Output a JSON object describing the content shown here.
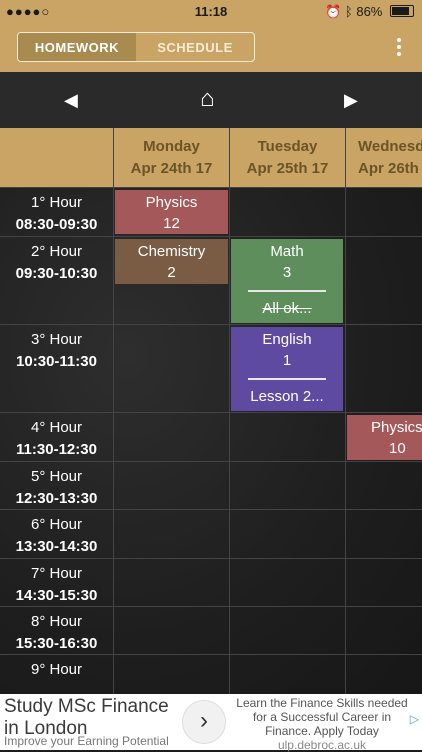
{
  "status_bar": {
    "signal": "●●●●○",
    "wifi": "WiFi",
    "time": "11:18",
    "battery": "86%"
  },
  "tabs": [
    {
      "label": "HOMEWORK",
      "active": true
    },
    {
      "label": "SCHEDULE",
      "active": false
    }
  ],
  "nav": {
    "prev": "◀",
    "home": "⌂",
    "next": "▶"
  },
  "days": [
    {
      "name": "Monday",
      "date": "Apr 24th 17"
    },
    {
      "name": "Tuesday",
      "date": "Apr 25th 17"
    },
    {
      "name": "Wednesd",
      "date": "Apr 26th"
    }
  ],
  "hours": [
    {
      "label": "1° Hour",
      "time": "08:30-09:30"
    },
    {
      "label": "2° Hour",
      "time": "09:30-10:30"
    },
    {
      "label": "3° Hour",
      "time": "10:30-11:30"
    },
    {
      "label": "4° Hour",
      "time": "11:30-12:30"
    },
    {
      "label": "5° Hour",
      "time": "12:30-13:30"
    },
    {
      "label": "6° Hour",
      "time": "13:30-14:30"
    },
    {
      "label": "7° Hour",
      "time": "14:30-15:30"
    },
    {
      "label": "8° Hour",
      "time": "15:30-16:30"
    },
    {
      "label": "9° Hour",
      "time": ""
    }
  ],
  "events": [
    {
      "subject": "Physics",
      "count": "12",
      "note": "",
      "color": "#a5585a"
    },
    {
      "subject": "Chemistry",
      "count": "2",
      "note": "",
      "color": "#7a5c44"
    },
    {
      "subject": "Math",
      "count": "3",
      "note": "All ok...",
      "color": "#5e8e5c"
    },
    {
      "subject": "English",
      "count": "1",
      "note": "Lesson 2...",
      "color": "#5e4aa0"
    },
    {
      "subject": "Physics",
      "count": "10",
      "note": "",
      "color": "#a5585a"
    }
  ],
  "ad": {
    "title": "Study MSc Finance in London",
    "subtitle": "Improve your Earning Potential",
    "arrow": "›",
    "body": "Learn the Finance Skills needed for a Successful Career in Finance. Apply Today",
    "url": "ulp.debroc.ac.uk",
    "badge": "▷"
  }
}
